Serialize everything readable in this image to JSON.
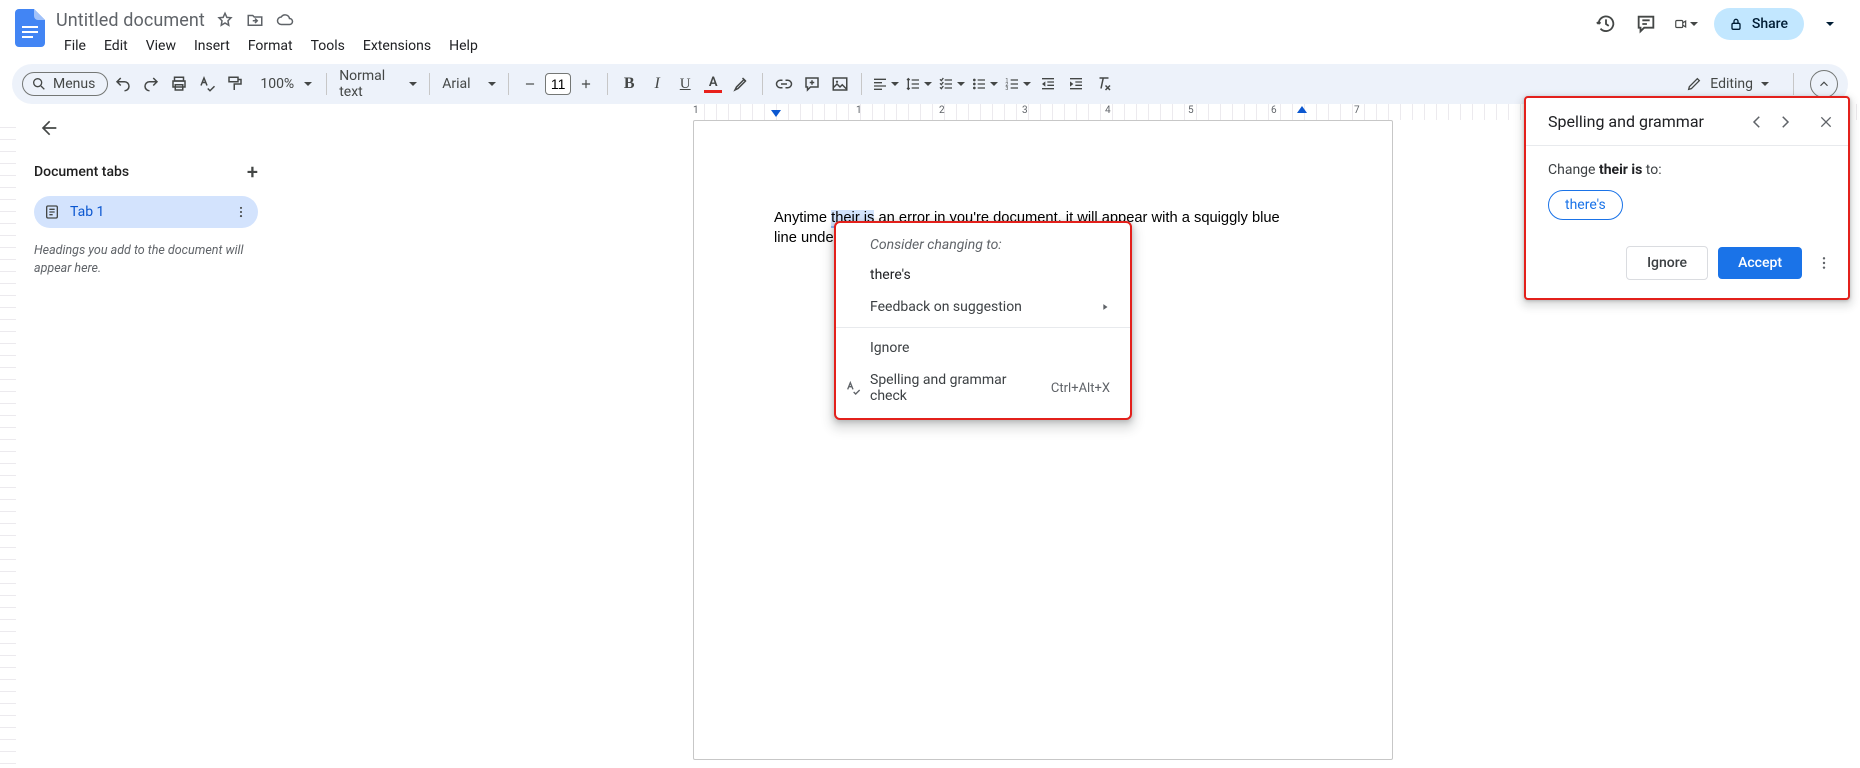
{
  "title": "Untitled document",
  "menus": [
    "File",
    "Edit",
    "View",
    "Insert",
    "Format",
    "Tools",
    "Extensions",
    "Help"
  ],
  "share_label": "Share",
  "toolbar": {
    "menus_pill": "Menus",
    "zoom": "100%",
    "para_style": "Normal text",
    "font": "Arial",
    "font_size": "11",
    "editing_label": "Editing"
  },
  "ruler_labels": [
    "1",
    "1",
    "2",
    "3",
    "4",
    "5",
    "6",
    "7"
  ],
  "side": {
    "header": "Document tabs",
    "tab": "Tab 1",
    "hint": "Headings you add to the document will appear here."
  },
  "doc_text": {
    "pre": "Anytime ",
    "err": "their is",
    "mid": " an error in ",
    "err2": "you're",
    "post": " document, it will appear with a squiggly blue line underneath it."
  },
  "context": {
    "consider": "Consider changing to:",
    "suggestion": "there's",
    "feedback": "Feedback on suggestion",
    "ignore": "Ignore",
    "check": "Spelling and grammar check",
    "shortcut": "Ctrl+Alt+X"
  },
  "spell": {
    "title": "Spelling and grammar",
    "change_prefix": "Change",
    "change_phrase": "their is",
    "change_suffix": "to:",
    "chip": "there's",
    "ignore": "Ignore",
    "accept": "Accept"
  }
}
